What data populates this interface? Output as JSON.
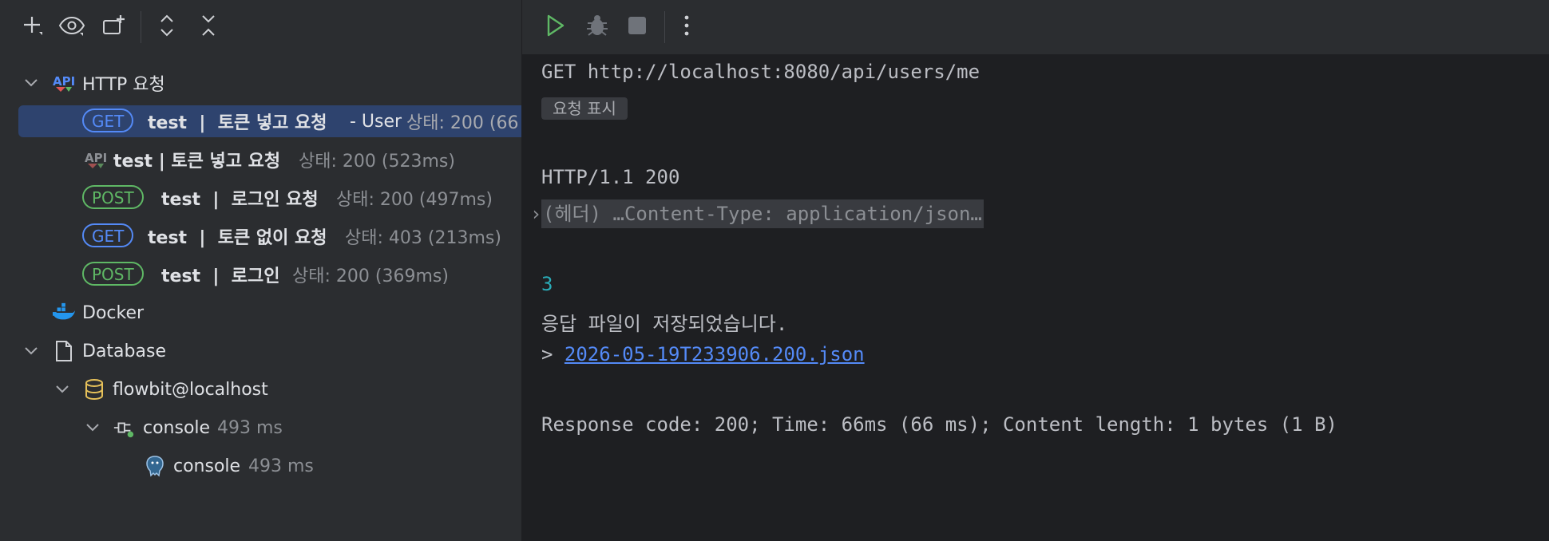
{
  "toolbar_left": {
    "icons": [
      "add-icon",
      "eye-icon",
      "new-tab-icon",
      "expand-all-icon",
      "collapse-all-icon"
    ]
  },
  "tree": {
    "http_group": {
      "label": "HTTP 요청"
    },
    "items": [
      {
        "method": "GET",
        "name": "test  |  토큰 넣고 요청",
        "extra": " - User",
        "status": "상태: 200 (66"
      },
      {
        "method": "",
        "name": "test | 토큰 넣고 요청",
        "extra": "",
        "status": "상태: 200 (523ms)"
      },
      {
        "method": "POST",
        "name": "test  |  로그인 요청",
        "extra": "",
        "status": "상태: 200 (497ms)"
      },
      {
        "method": "GET",
        "name": "test  |  토큰 없이 요청",
        "extra": "",
        "status": "상태: 403 (213ms)"
      },
      {
        "method": "POST",
        "name": "test  |  로그인",
        "extra": "",
        "status": "상태: 200 (369ms)"
      }
    ],
    "docker": {
      "label": "Docker"
    },
    "database": {
      "label": "Database"
    },
    "datasource": {
      "label": "flowbit@localhost"
    },
    "console_session": {
      "label": "console",
      "time": "493 ms"
    },
    "console_child": {
      "label": "console",
      "time": "493 ms"
    }
  },
  "toolbar_right": {
    "icons": [
      "run-icon",
      "debug-icon",
      "stop-icon",
      "more-icon"
    ]
  },
  "output": {
    "request_line": "GET http://localhost:8080/api/users/me",
    "show_request": "요청 표시",
    "status_line": "HTTP/1.1 200",
    "headers_collapsed": "(헤더) …Content-Type: application/json…",
    "body": "3",
    "saved_msg": "응답 파일이 저장되었습니다.",
    "prompt": ">",
    "file_link": "2026-05-19T233906.200.json",
    "summary": "Response code: 200; Time: 66ms (66 ms); Content length: 1 bytes (1 B)"
  },
  "colors": {
    "accent_get": "#548af7",
    "accent_post": "#5fb865",
    "selected_row": "#2e436e",
    "run_green": "#5fb865"
  }
}
